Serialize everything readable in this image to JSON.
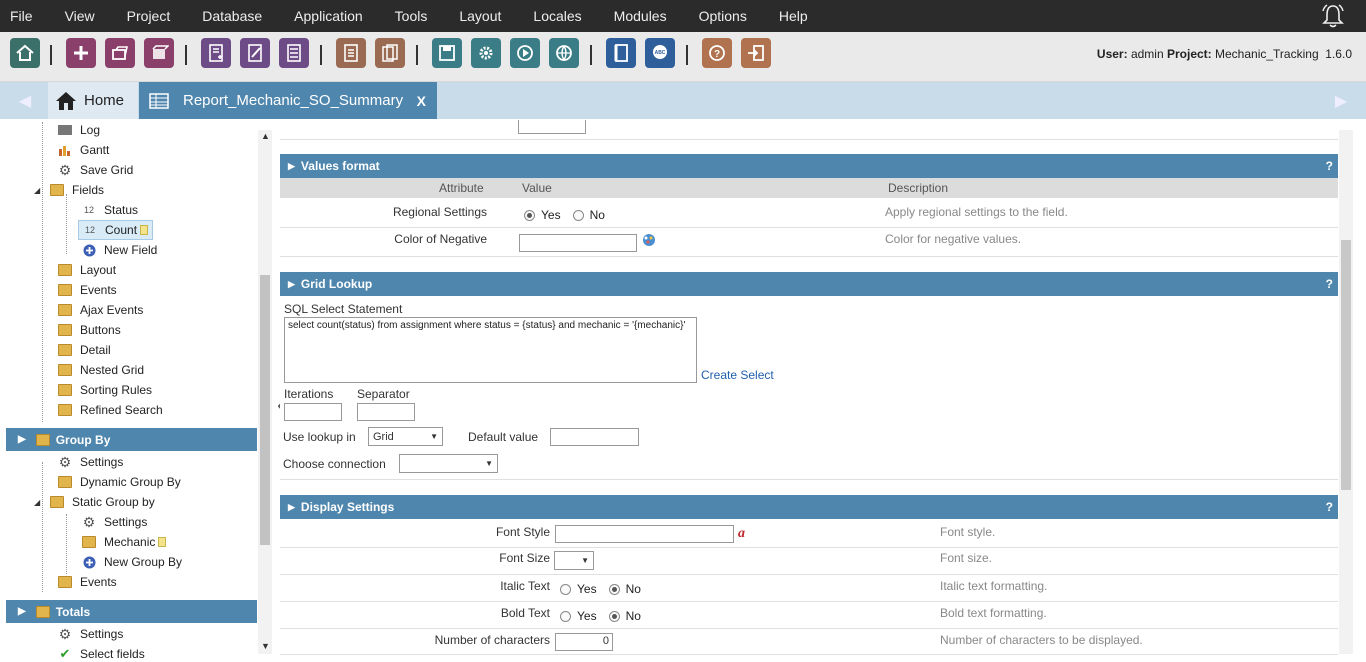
{
  "menu": [
    "File",
    "View",
    "Project",
    "Database",
    "Application",
    "Tools",
    "Layout",
    "Locales",
    "Modules",
    "Options",
    "Help"
  ],
  "toolbar": {
    "icons": [
      "home-icon",
      "add-icon",
      "open-icon",
      "box-icon",
      "new-app-icon",
      "edit-app-icon",
      "list-app-icon",
      "document-icon",
      "documents-icon",
      "save-icon",
      "gear-icon",
      "play-icon",
      "globe-icon",
      "book-icon",
      "spellcheck-icon",
      "help-icon",
      "exit-icon"
    ],
    "user_label": "User:",
    "user": "admin",
    "project_label": "Project:",
    "project": "Mechanic_Tracking",
    "version": "1.6.0"
  },
  "tabs": {
    "home": "Home",
    "active": "Report_Mechanic_SO_Summary",
    "close": "X"
  },
  "sidebar": {
    "items": [
      "Log",
      "Gantt",
      "Save Grid",
      "Fields",
      "Status",
      "Count",
      "New Field",
      "Layout",
      "Events",
      "Ajax Events",
      "Buttons",
      "Detail",
      "Nested Grid",
      "Sorting Rules",
      "Refined Search"
    ],
    "field_prefix": "12",
    "group_by": "Group By",
    "group_items": [
      "Settings",
      "Dynamic Group By",
      "Static Group by",
      "Settings",
      "Mechanic",
      "New Group By",
      "Events"
    ],
    "totals": "Totals",
    "totals_items": [
      "Settings",
      "Select fields"
    ]
  },
  "values_format": {
    "title": "Values format",
    "help": "?",
    "col_attribute": "Attribute",
    "col_value": "Value",
    "col_description": "Description",
    "regional_label": "Regional Settings",
    "yes": "Yes",
    "no": "No",
    "regional_desc": "Apply regional settings to the field.",
    "negative_label": "Color of Negative",
    "negative_value": "",
    "negative_desc": "Color for negative values."
  },
  "grid_lookup": {
    "title": "Grid Lookup",
    "help": "?",
    "sql_label": "SQL Select Statement",
    "sql": "select count(status) from assignment where status = {status} and mechanic = '{mechanic}'",
    "create_select": "Create Select",
    "iterations_label": "Iterations",
    "separator_label": "Separator",
    "use_lookup_label": "Use lookup in",
    "use_lookup_value": "Grid",
    "default_value_label": "Default value",
    "choose_connection_label": "Choose connection",
    "choose_connection_value": ""
  },
  "display_settings": {
    "title": "Display Settings",
    "help": "?",
    "font_style_label": "Font Style",
    "font_style_desc": "Font style.",
    "font_size_label": "Font Size",
    "font_size_desc": "Font size.",
    "italic_label": "Italic Text",
    "italic_desc": "Italic text formatting.",
    "bold_label": "Bold Text",
    "bold_desc": "Bold text formatting.",
    "chars_label": "Number of characters",
    "chars_value": "0",
    "chars_desc": "Number of characters to be displayed.",
    "yes": "Yes",
    "no": "No"
  }
}
